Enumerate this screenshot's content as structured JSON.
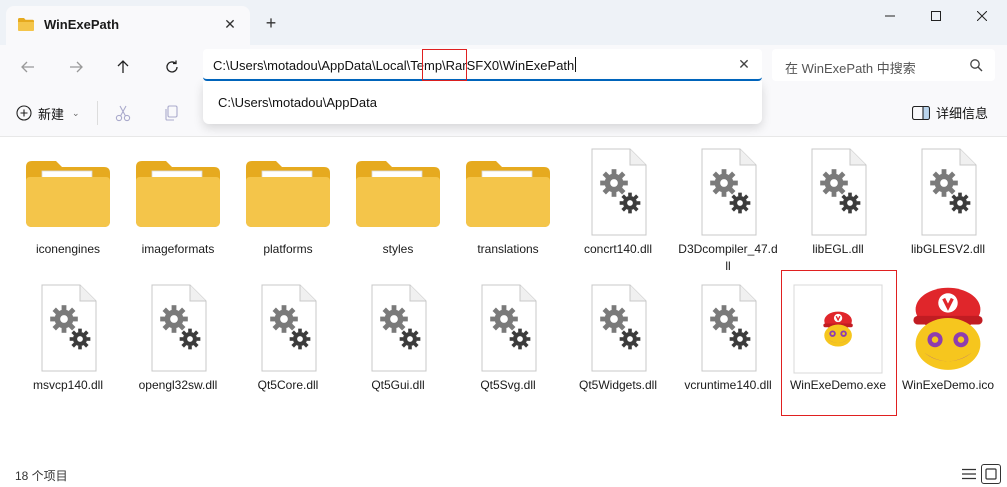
{
  "window": {
    "tab_title": "WinExePath",
    "tab_close": "✕",
    "new_tab": "+"
  },
  "navigation": {
    "address_path": "C:\\Users\\motadou\\AppData\\Local\\Temp\\RarSFX0\\WinExePath",
    "address_clear": "✕",
    "search_placeholder": "在 WinExePath 中搜索",
    "suggestion": "C:\\Users\\motadou\\AppData"
  },
  "commands": {
    "new_label": "新建",
    "new_caret": "⌄",
    "details_label": "详细信息"
  },
  "files": [
    {
      "name": "iconengines",
      "type": "folder"
    },
    {
      "name": "imageformats",
      "type": "folder"
    },
    {
      "name": "platforms",
      "type": "folder"
    },
    {
      "name": "styles",
      "type": "folder"
    },
    {
      "name": "translations",
      "type": "folder-plain"
    },
    {
      "name": "concrt140.dll",
      "type": "dll"
    },
    {
      "name": "D3Dcompiler_47.dll",
      "type": "dll"
    },
    {
      "name": "libEGL.dll",
      "type": "dll"
    },
    {
      "name": "libGLESV2.dll",
      "type": "dll"
    },
    {
      "name": "msvcp140.dll",
      "type": "dll"
    },
    {
      "name": "opengl32sw.dll",
      "type": "dll"
    },
    {
      "name": "Qt5Core.dll",
      "type": "dll"
    },
    {
      "name": "Qt5Gui.dll",
      "type": "dll"
    },
    {
      "name": "Qt5Svg.dll",
      "type": "dll"
    },
    {
      "name": "Qt5Widgets.dll",
      "type": "dll"
    },
    {
      "name": "vcruntime140.dll",
      "type": "dll"
    },
    {
      "name": "WinExeDemo.exe",
      "type": "exe"
    },
    {
      "name": "WinExeDemo.ico",
      "type": "ico"
    }
  ],
  "status": {
    "item_count": "18 个项目"
  },
  "colors": {
    "accent": "#0067c0",
    "highlight_box": "#e02020",
    "folder": "#f4c54a",
    "folder_dark": "#e6aa1f"
  }
}
